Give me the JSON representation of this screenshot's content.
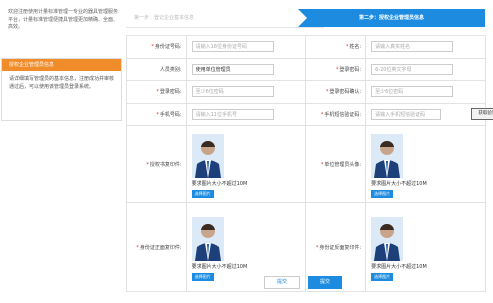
{
  "intro": "欢迎注册使用计量标准管理一专业的器具管理服务平台，计量标准管理便捷具管理更加精确、全面、高效。",
  "side": {
    "title": "授权企业管理员信息",
    "body": "请详细填写管理员的基本信息，注册成功并审核通过后，可以使用该管理员登录系统。"
  },
  "steps": {
    "step1": "第一步：登记企业基本信息",
    "step2": "第二步：授权企业管理员信息"
  },
  "form": {
    "id_number": {
      "label": "身份证号码:",
      "placeholder": "请输入18位身份证号码"
    },
    "name": {
      "label": "姓名:",
      "placeholder": "请输入真实姓名"
    },
    "role": {
      "label": "人员类别:",
      "value": "使用单位管理员"
    },
    "password": {
      "label": "登录密码:",
      "placeholder": "6-20位英文字母"
    },
    "reg_password": {
      "label": "登录密码:",
      "placeholder": "至少6位密码"
    },
    "confirm_password": {
      "label": "登录密码确认:",
      "placeholder": "至少6位密码"
    },
    "phone": {
      "label": "手机号码:",
      "placeholder": "请输入11位手机号"
    },
    "code": {
      "label": "手机短信验证码:",
      "placeholder": "请输入手机短信验证码",
      "button": "获取验证码"
    },
    "auth_letter": {
      "label": "授权书复印件:"
    },
    "unit_id": {
      "label": "单位管理员头像:"
    },
    "id_front": {
      "label": "身份证正面复印件:"
    },
    "id_back": {
      "label": "身份证反面复印件:"
    },
    "upload_req": "要求图片大小不超过10M",
    "select_image": "选择图片"
  },
  "buttons": {
    "prev": "提交",
    "submit": "提交"
  },
  "colors": {
    "accent": "#1d8ce0",
    "orange": "#f08c2a",
    "required": "#e03030"
  }
}
